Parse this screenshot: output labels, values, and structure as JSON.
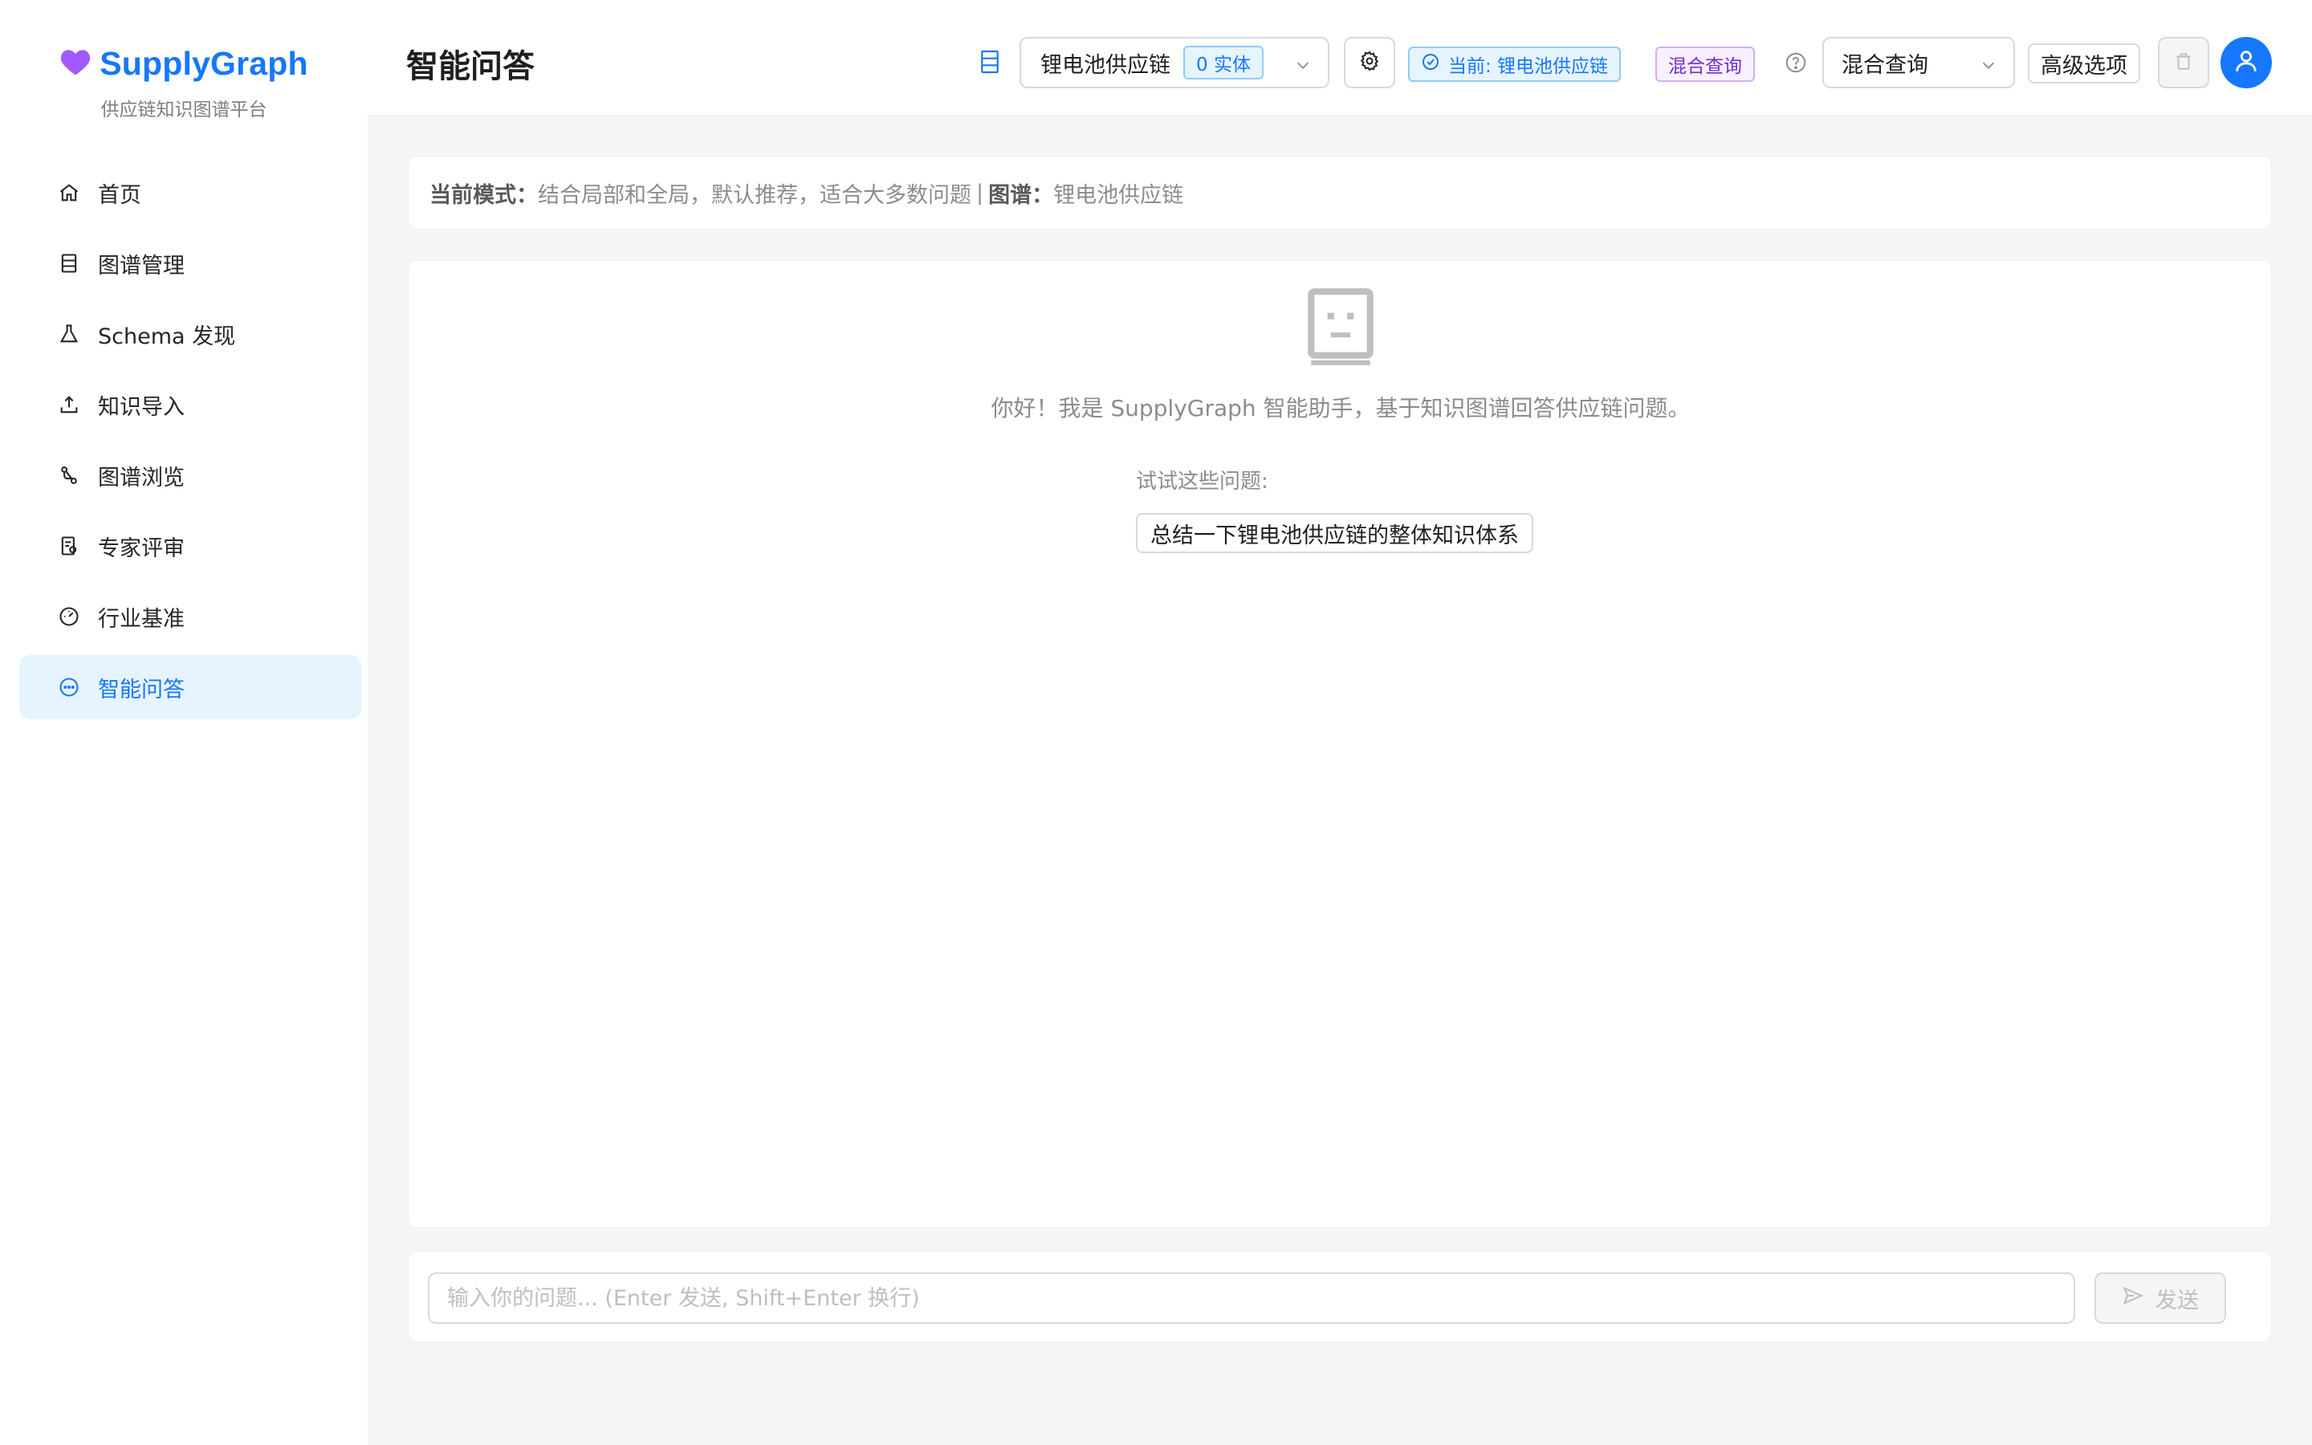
{
  "brand": {
    "name": "SupplyGraph",
    "subtitle": "供应链知识图谱平台"
  },
  "sidebar": {
    "items": [
      {
        "label": "首页",
        "icon": "home-icon",
        "active": false
      },
      {
        "label": "图谱管理",
        "icon": "database-icon",
        "active": false
      },
      {
        "label": "Schema 发现",
        "icon": "flask-icon",
        "active": false
      },
      {
        "label": "知识导入",
        "icon": "upload-icon",
        "active": false
      },
      {
        "label": "图谱浏览",
        "icon": "graph-icon",
        "active": false
      },
      {
        "label": "专家评审",
        "icon": "audit-icon",
        "active": false
      },
      {
        "label": "行业基准",
        "icon": "dashboard-icon",
        "active": false
      },
      {
        "label": "智能问答",
        "icon": "chat-icon",
        "active": true
      }
    ]
  },
  "header": {
    "title": "智能问答",
    "graph_select": {
      "value": "锂电池供应链",
      "count_tag": "0 实体"
    },
    "current_tag": "当前: 锂电池供应链",
    "mode_tag": "混合查询",
    "mode_select": {
      "value": "混合查询"
    },
    "advanced_label": "高级选项"
  },
  "banner": {
    "mode_label": "当前模式",
    "mode_desc": "结合局部和全局，默认推荐，适合大多数问题",
    "separator": "|",
    "graph_label": "图谱",
    "graph_name": "锂电池供应链"
  },
  "chat": {
    "welcome": "你好！我是 SupplyGraph 智能助手，基于知识图谱回答供应链问题。",
    "try_label": "试试这些问题:",
    "suggestions": [
      "总结一下锂电池供应链的整体知识体系"
    ]
  },
  "input": {
    "placeholder": "输入你的问题... (Enter 发送, Shift+Enter 换行)",
    "send_label": "发送"
  },
  "colors": {
    "primary": "#1677ff",
    "active_bg": "#e6f4ff",
    "purple": "#722ed1",
    "heart": "#9b59e6"
  }
}
